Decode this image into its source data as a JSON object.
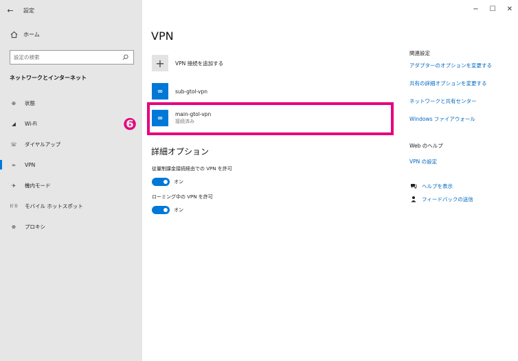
{
  "window": {
    "back_glyph": "←",
    "title": "設定",
    "minimize": "−",
    "maximize": "☐",
    "close": "✕"
  },
  "sidebar": {
    "home": {
      "label": "ホーム",
      "icon": "home-icon"
    },
    "search": {
      "placeholder": "設定の検索",
      "icon": "search-icon"
    },
    "section_title": "ネットワークとインターネット",
    "items": [
      {
        "label": "状態",
        "icon": "status-icon",
        "glyph": "⊕"
      },
      {
        "label": "Wi-Fi",
        "icon": "wifi-icon",
        "glyph": "◢"
      },
      {
        "label": "ダイヤルアップ",
        "icon": "dialup-icon",
        "glyph": "☏"
      },
      {
        "label": "VPN",
        "icon": "vpn-icon",
        "glyph": "∞"
      },
      {
        "label": "機内モード",
        "icon": "airplane-icon",
        "glyph": "✈"
      },
      {
        "label": "モバイル ホットスポット",
        "icon": "hotspot-icon",
        "glyph": "((·))"
      },
      {
        "label": "プロキシ",
        "icon": "globe-icon",
        "glyph": "⊕"
      }
    ],
    "active_index": 3
  },
  "annotation": {
    "step_badge": "❻",
    "color": "#e6007e"
  },
  "main": {
    "title": "VPN",
    "add_vpn_label": "VPN 接続を追加する",
    "connections": [
      {
        "name": "sub-gtol-vpn",
        "status": ""
      },
      {
        "name": "main-gtol-vpn",
        "status": "接続済み"
      }
    ],
    "advanced": {
      "heading": "詳細オプション",
      "options": [
        {
          "label": "従量制課金接続経由での VPN を許可",
          "state": "オン"
        },
        {
          "label": "ローミング中の VPN を許可",
          "state": "オン"
        }
      ]
    }
  },
  "related": {
    "heading": "関連設定",
    "links": [
      "アダプターのオプションを変更する",
      "共有の詳細オプションを変更する",
      "ネットワークと共有センター",
      "Windows ファイアウォール"
    ],
    "web_help_heading": "Web のヘルプ",
    "web_help_link": "VPN の設定",
    "help_link": "ヘルプを表示",
    "feedback_link": "フィードバックの送信"
  },
  "colors": {
    "accent": "#0078d7",
    "link": "#0067c0",
    "highlight": "#e6007e",
    "sidebar_bg": "#e6e6e6"
  }
}
